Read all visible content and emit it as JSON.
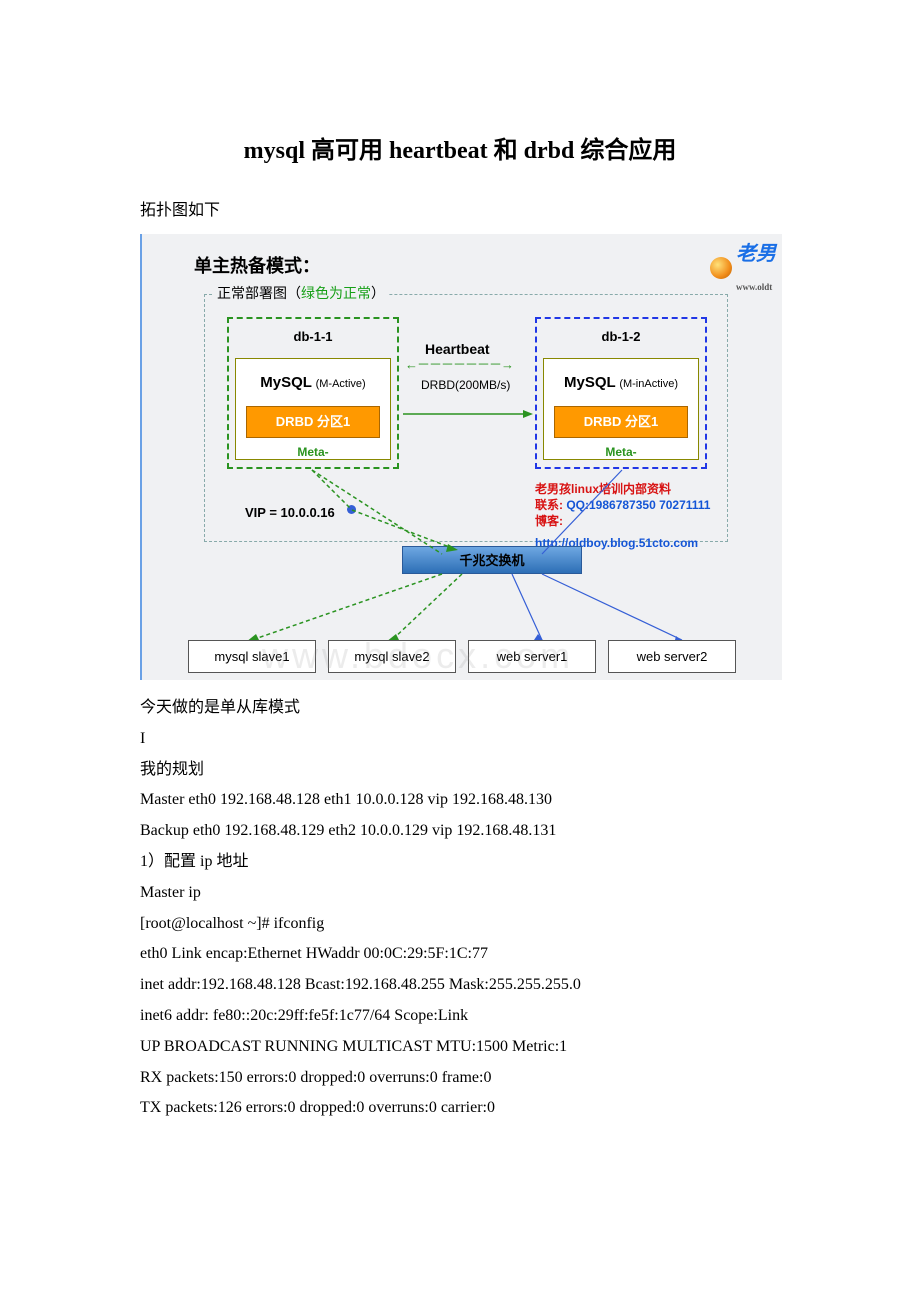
{
  "title": "mysql 高可用 heartbeat 和 drbd 综合应用",
  "intro": "拓扑图如下",
  "diagram": {
    "logo_text": "老男",
    "logo_sub": "www.oldt",
    "mode_title": "单主热备模式：",
    "group_label_pre": "正常部署图（",
    "group_label_green": "绿色为正常",
    "group_label_post": "）",
    "node_left": {
      "name": "db-1-1",
      "db": "MySQL",
      "db_state": "(M-Active)",
      "drbd": "DRBD 分区1",
      "meta": "Meta-"
    },
    "node_right": {
      "name": "db-1-2",
      "db": "MySQL",
      "db_state": "(M-inActive)",
      "drbd": "DRBD 分区1",
      "meta": "Meta-"
    },
    "hb": "Heartbeat",
    "hb_arrow": "←－－－－－－－→",
    "drbd_speed": "DRBD(200MB/s)",
    "vip": "VIP = 10.0.0.16",
    "info1": "老男孩linux培训内部资料",
    "info2_label": "联系:",
    "info2_val": " QQ:1986787350 70271111",
    "info3_label": "博客:",
    "info3_val": " http://oldboy.blog.51cto.com",
    "switch": "千兆交换机",
    "servers": [
      "mysql slave1",
      "mysql slave2",
      "web server1",
      "web server2"
    ],
    "watermark": "www.bdocx.com"
  },
  "body_lines": [
    "今天做的是单从库模式",
    "I",
    "我的规划",
    "Master eth0 192.168.48.128 eth1 10.0.0.128 vip 192.168.48.130",
    "Backup eth0 192.168.48.129 eth2 10.0.0.129 vip 192.168.48.131",
    "1）配置 ip 地址",
    "Master ip",
    "[root@localhost ~]# ifconfig",
    "eth0 Link encap:Ethernet HWaddr 00:0C:29:5F:1C:77",
    " inet addr:192.168.48.128 Bcast:192.168.48.255 Mask:255.255.255.0",
    " inet6 addr: fe80::20c:29ff:fe5f:1c77/64 Scope:Link",
    " UP BROADCAST RUNNING MULTICAST MTU:1500 Metric:1",
    " RX packets:150 errors:0 dropped:0 overruns:0 frame:0",
    " TX packets:126 errors:0 dropped:0 overruns:0 carrier:0"
  ]
}
